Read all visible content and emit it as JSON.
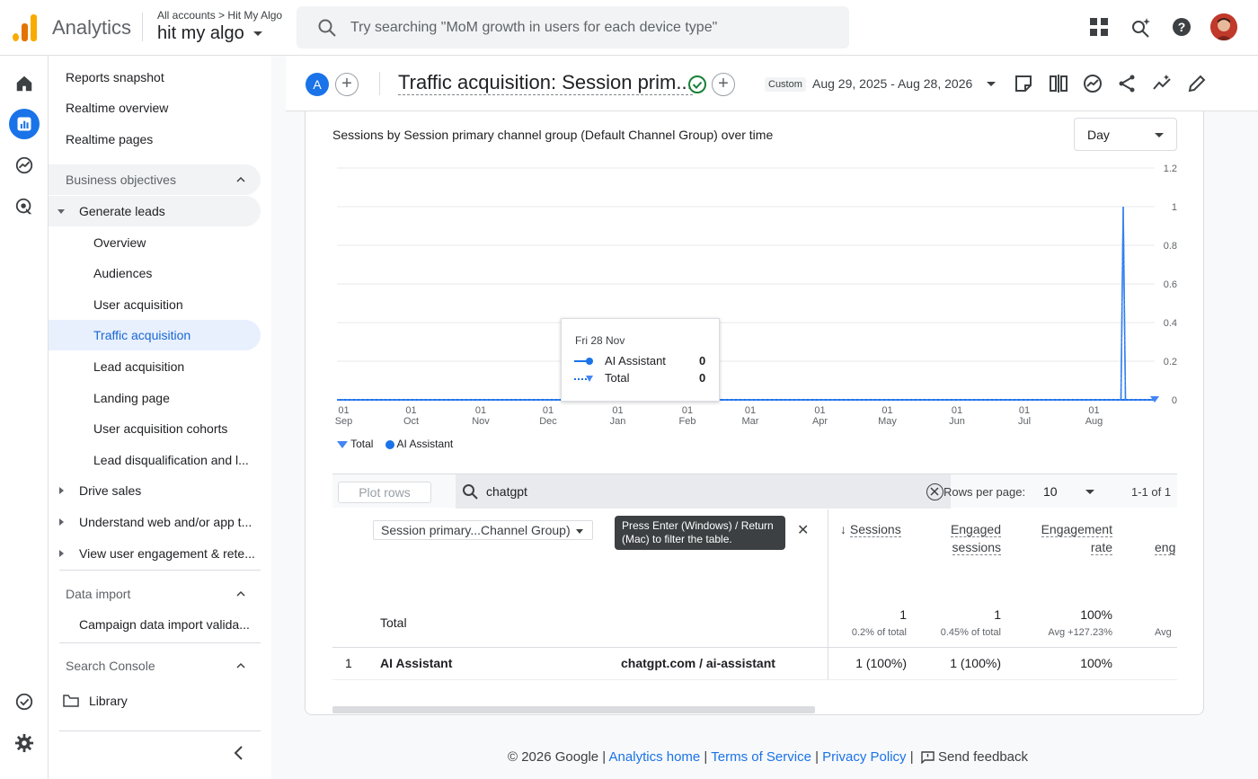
{
  "app": {
    "name": "Analytics"
  },
  "account": {
    "breadcrumb_all": "All accounts",
    "breadcrumb_sep": ">",
    "breadcrumb_property": "Hit My Algo",
    "name": "hit my algo"
  },
  "search": {
    "placeholder": "Try searching \"MoM growth in users for each device type\""
  },
  "topbar_icons": [
    "apps-grid-icon",
    "search-insights-icon",
    "help-icon",
    "account-avatar"
  ],
  "rail_icons": [
    "home-icon",
    "reports-icon",
    "explore-icon",
    "advertising-icon",
    "admin-checklist-icon",
    "settings-gear-icon"
  ],
  "nav": {
    "reports_snapshot": "Reports snapshot",
    "realtime_overview": "Realtime overview",
    "realtime_pages": "Realtime pages",
    "business_objectives": "Business objectives",
    "generate_leads": "Generate leads",
    "leads_children": [
      "Overview",
      "Audiences",
      "User acquisition",
      "Traffic acquisition",
      "Lead acquisition",
      "Landing page",
      "User acquisition cohorts",
      "Lead disqualification and l..."
    ],
    "drive_sales": "Drive sales",
    "understand_web": "Understand web and/or app t...",
    "view_engagement": "View user engagement & rete...",
    "data_import": "Data import",
    "campaign_data": "Campaign data import valida...",
    "search_console": "Search Console",
    "library": "Library"
  },
  "report": {
    "comparison_badge": "A",
    "title": "Traffic acquisition: Session prim...",
    "date_label": "Custom",
    "date_range": "Aug 29, 2025 - Aug 28, 2026"
  },
  "chart": {
    "title": "Sessions by Session primary channel group (Default Channel Group) over time",
    "granularity": "Day",
    "tooltip": {
      "date": "Fri 28 Nov",
      "rows": [
        {
          "name": "AI Assistant",
          "value": "0"
        },
        {
          "name": "Total",
          "value": "0"
        }
      ]
    },
    "legend": [
      "Total",
      "AI Assistant"
    ]
  },
  "chart_data": {
    "type": "line",
    "x_ticks": [
      {
        "top": "01",
        "bottom": "Sep"
      },
      {
        "top": "01",
        "bottom": "Oct"
      },
      {
        "top": "01",
        "bottom": "Nov"
      },
      {
        "top": "01",
        "bottom": "Dec"
      },
      {
        "top": "01",
        "bottom": "Jan"
      },
      {
        "top": "01",
        "bottom": "Feb"
      },
      {
        "top": "01",
        "bottom": "Mar"
      },
      {
        "top": "01",
        "bottom": "Apr"
      },
      {
        "top": "01",
        "bottom": "May"
      },
      {
        "top": "01",
        "bottom": "Jun"
      },
      {
        "top": "01",
        "bottom": "Jul"
      },
      {
        "top": "01",
        "bottom": "Aug"
      }
    ],
    "y_ticks": [
      "0",
      "0.2",
      "0.4",
      "0.6",
      "0.8",
      "1",
      "1.2"
    ],
    "ylim": [
      0,
      1.2
    ],
    "x_range": [
      "2025-08-29",
      "2026-08-28"
    ],
    "series": [
      {
        "name": "AI Assistant",
        "color": "#1a73e8",
        "x": [
          "2025-08-29",
          "2026-08-13",
          "2026-08-14",
          "2026-08-15",
          "2026-08-28"
        ],
        "values": [
          0,
          0,
          1,
          0,
          0
        ]
      },
      {
        "name": "Total",
        "color": "#4285f4",
        "dashed": true,
        "x": [
          "2025-08-29",
          "2026-08-13",
          "2026-08-14",
          "2026-08-15",
          "2026-08-28"
        ],
        "values": [
          0,
          0,
          1,
          0,
          0
        ]
      }
    ]
  },
  "table": {
    "plot_rows": "Plot rows",
    "search_value": "chatgpt",
    "rows_per_page_label": "Rows per page:",
    "rows_per_page": "10",
    "pager": "1-1 of 1",
    "dimension_select": "Session primary...Channel Group)",
    "filter_tooltip": "Press Enter (Windows) / Return (Mac) to filter the table.",
    "columns": [
      "Sessions",
      "Engaged sessions",
      "Engagement rate",
      "eng"
    ],
    "total": {
      "label": "Total",
      "sessions": "1",
      "sessions_sub": "0.2% of total",
      "engaged": "1",
      "engaged_sub": "0.45% of total",
      "rate": "100%",
      "rate_sub": "Avg +127.23%",
      "eng_sub": "Avg"
    },
    "rows": [
      {
        "index": "1",
        "channel": "AI Assistant",
        "source": "chatgpt.com / ai-assistant",
        "sessions": "1 (100%)",
        "engaged": "1 (100%)",
        "rate": "100%"
      }
    ]
  },
  "footer": {
    "copyright": "© 2026 Google |",
    "analytics_home": "Analytics home",
    "terms": "Terms of Service",
    "privacy": "Privacy Policy",
    "feedback": "Send feedback"
  }
}
